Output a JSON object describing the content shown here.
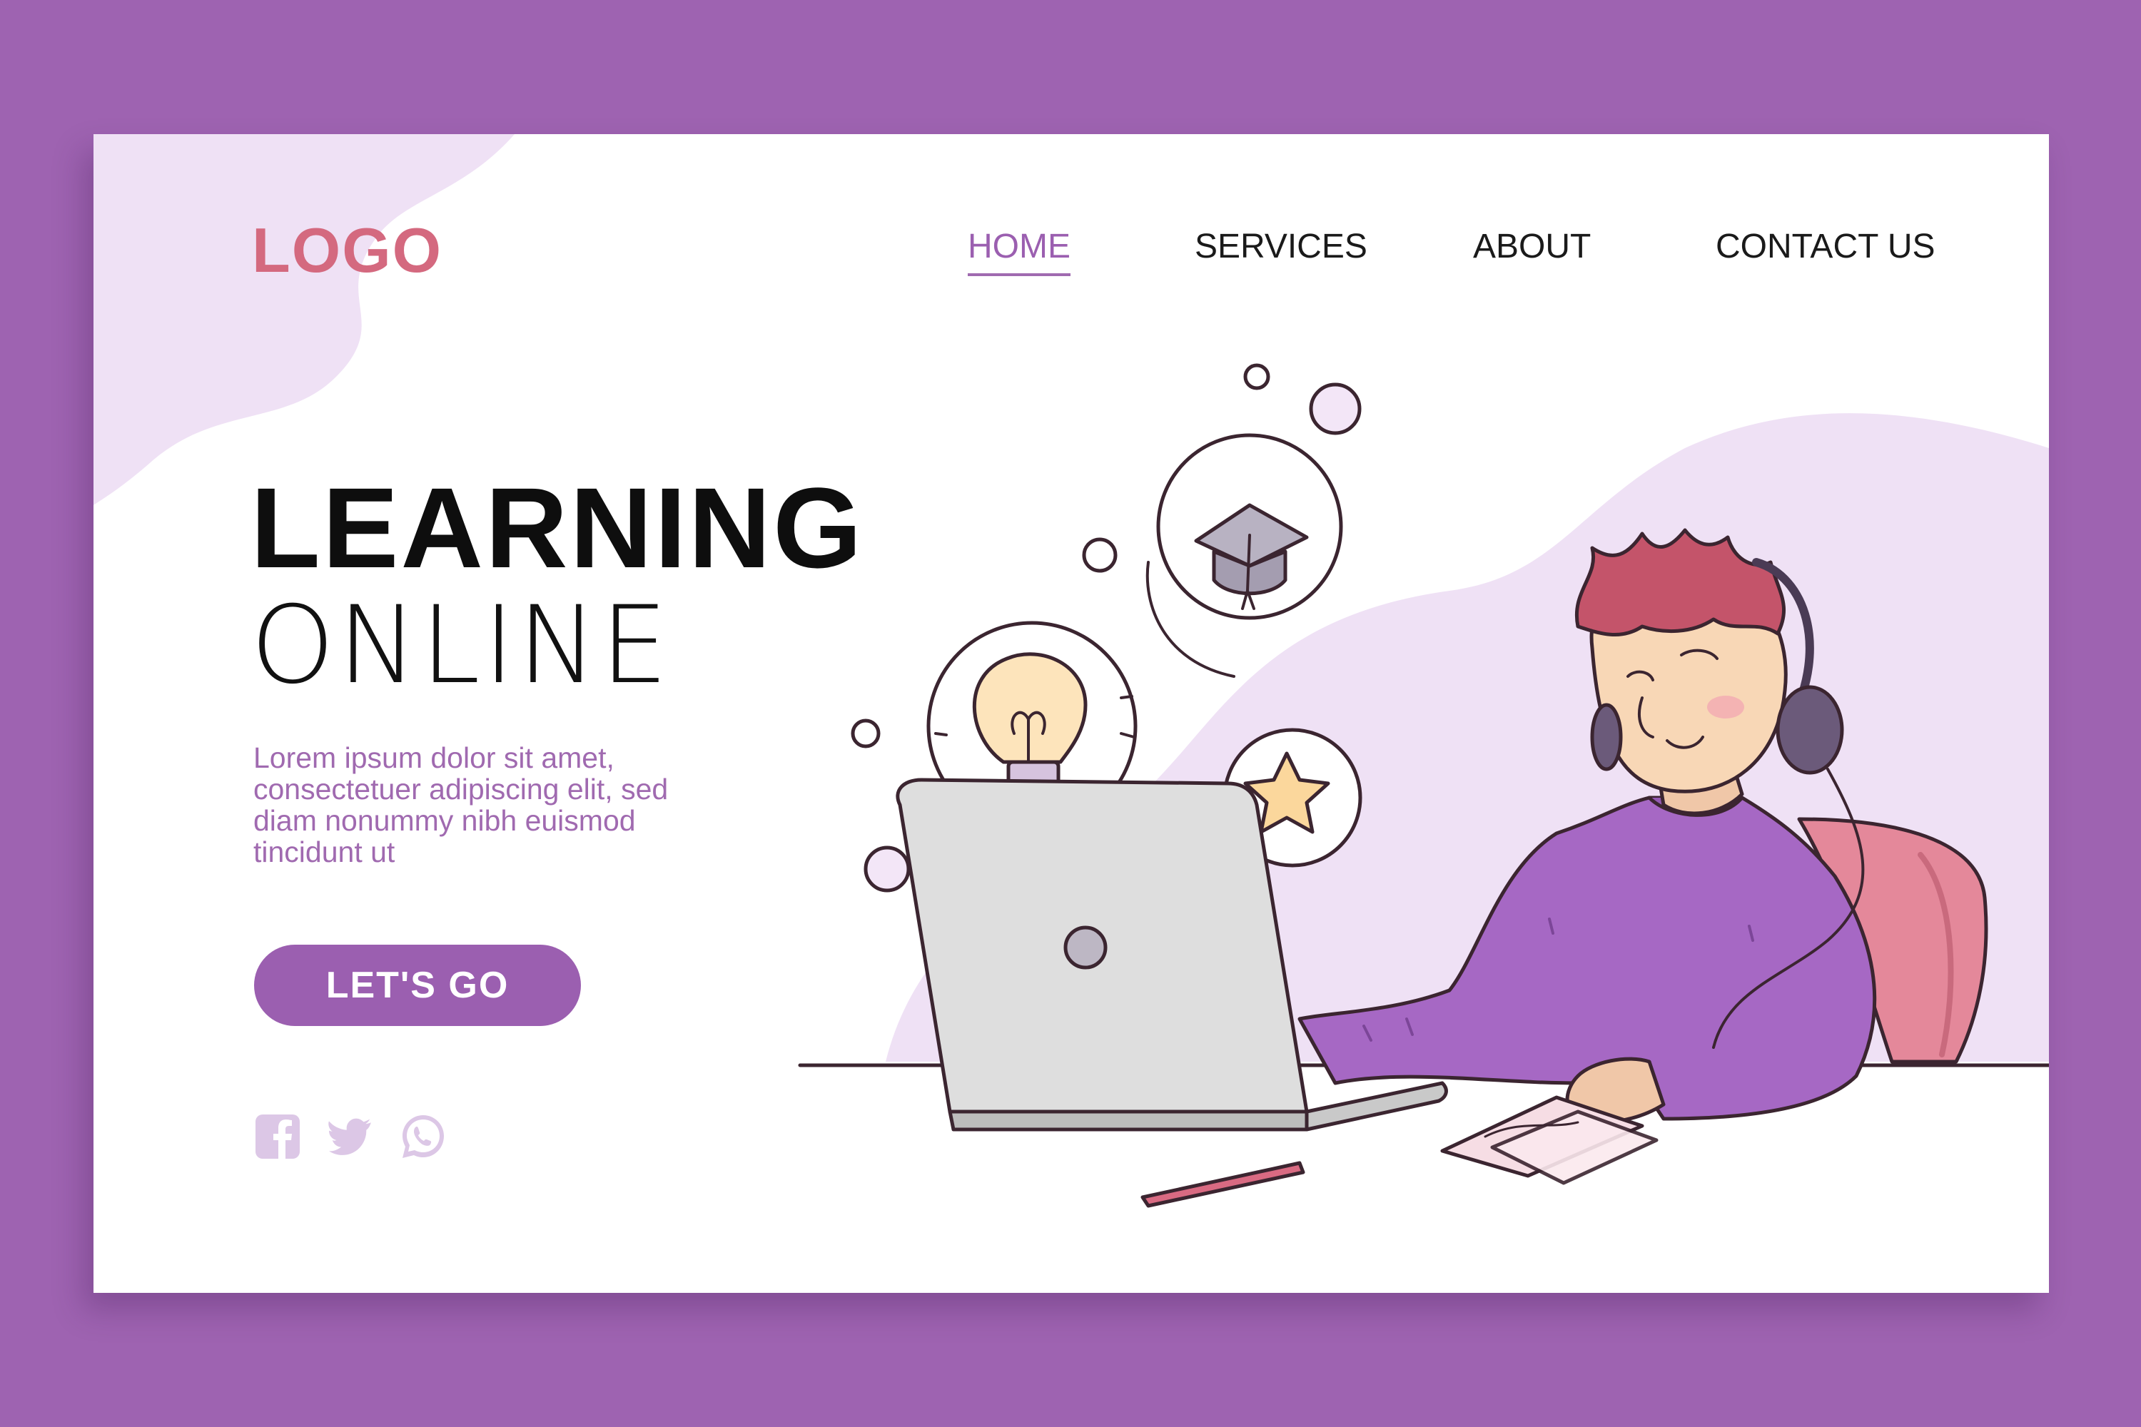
{
  "header": {
    "logo": "LOGO",
    "nav": {
      "home": "HOME",
      "services": "SERVICES",
      "about": "ABOUT",
      "contact": "CONTACT US"
    }
  },
  "hero": {
    "title_line1": "LEARNING",
    "title_line2": "ONLINE",
    "body": "Lorem ipsum dolor sit amet, consectetuer adipiscing elit, sed diam nonummy nibh euismod tincidunt ut",
    "cta_label": "LET'S GO"
  },
  "social": {
    "icons": [
      "facebook-icon",
      "twitter-icon",
      "whatsapp-icon"
    ]
  },
  "illustration": {
    "icons": [
      "graduation-cap-icon",
      "lightbulb-icon",
      "star-icon",
      "laptop",
      "headphones",
      "pen",
      "paper"
    ]
  },
  "colors": {
    "frame": "#9e63b1",
    "accent": "#9b5fb0",
    "logo": "#d4697f",
    "body_text": "#a06ab0",
    "blob": "#efe1f5",
    "social_icon": "#dcc7e6"
  }
}
